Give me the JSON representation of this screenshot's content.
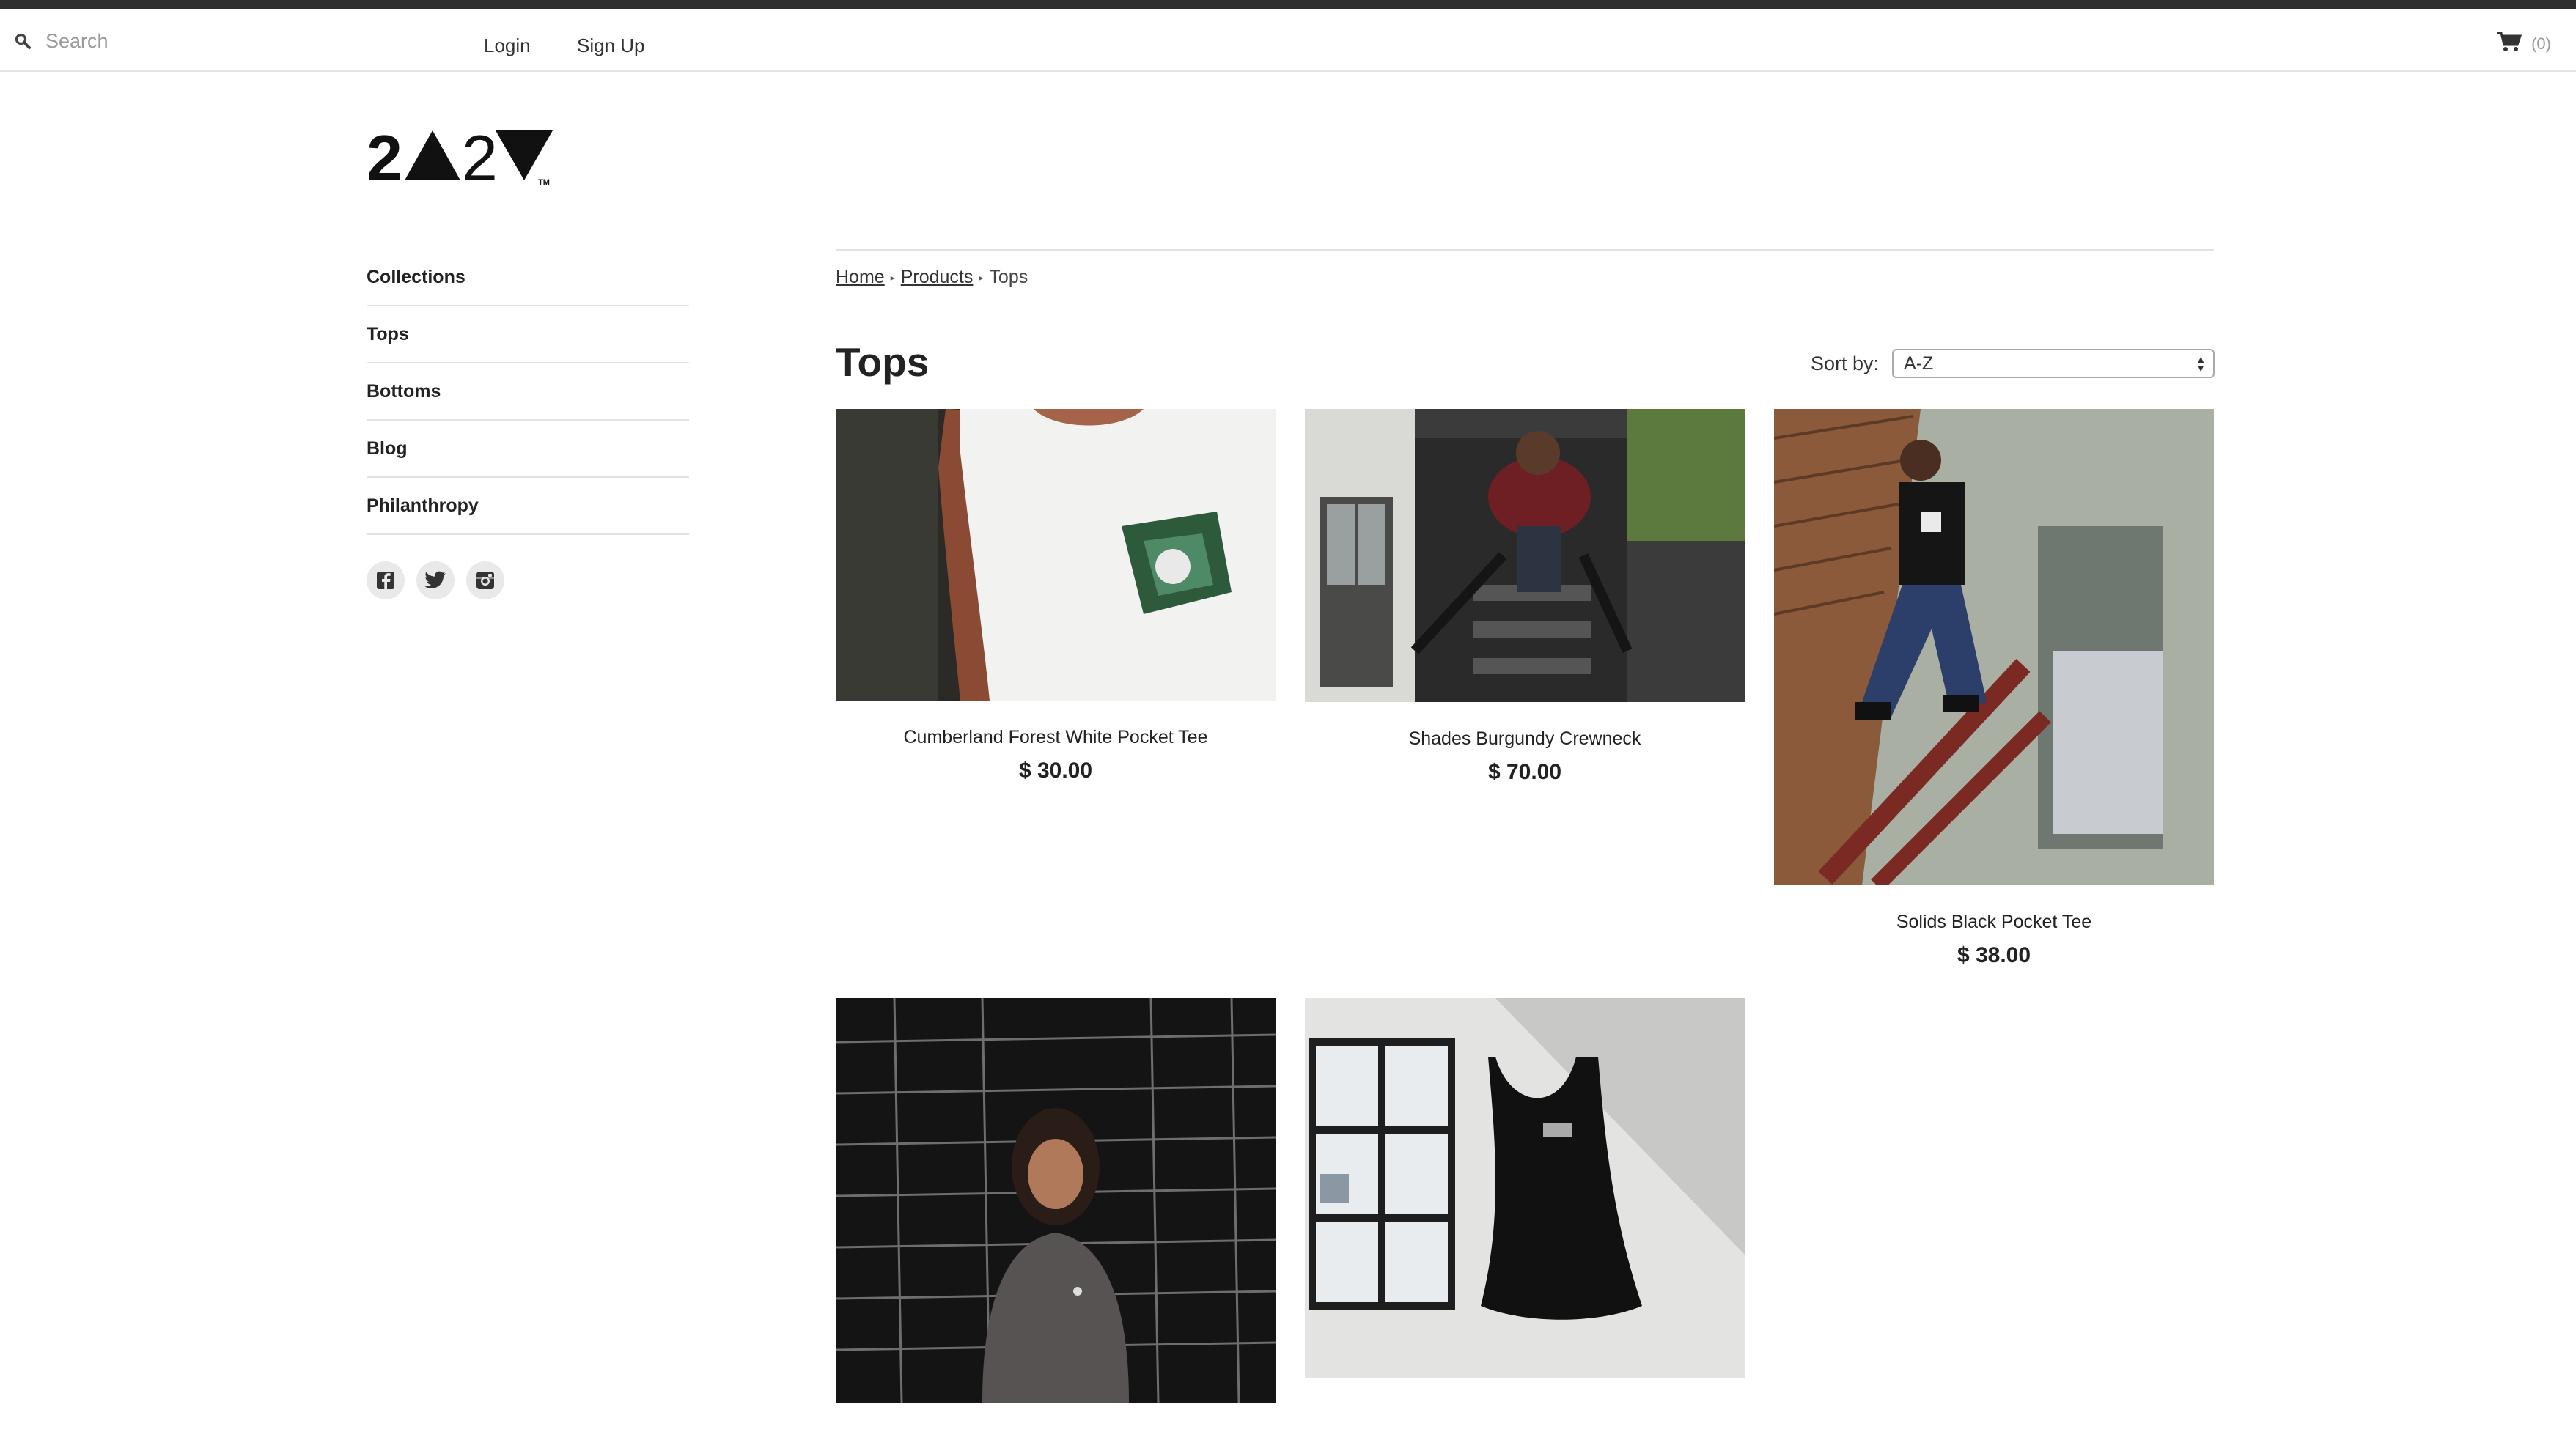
{
  "header": {
    "search_placeholder": "Search",
    "login_label": "Login",
    "signup_label": "Sign Up",
    "cart_count": "(0)"
  },
  "sidebar": {
    "items": [
      {
        "label": "Collections"
      },
      {
        "label": "Tops"
      },
      {
        "label": "Bottoms"
      },
      {
        "label": "Blog"
      },
      {
        "label": "Philanthropy"
      }
    ],
    "social_icons": [
      "facebook-icon",
      "twitter-icon",
      "instagram-icon"
    ]
  },
  "breadcrumb": {
    "home": "Home",
    "products": "Products",
    "current": "Tops"
  },
  "page": {
    "title": "Tops",
    "sort_label": "Sort by:",
    "sort_value": "A-Z"
  },
  "products": [
    {
      "name": "Cumberland Forest White Pocket Tee",
      "price": "$ 30.00"
    },
    {
      "name": "Shades Burgundy Crewneck",
      "price": "$ 70.00"
    },
    {
      "name": "Solids Black Pocket Tee",
      "price": "$ 38.00"
    },
    {
      "name": "",
      "price": ""
    },
    {
      "name": "",
      "price": ""
    }
  ],
  "colors": {
    "top_stripe": "#2f2f2f",
    "text": "#222222",
    "muted": "#9a9a9a"
  }
}
